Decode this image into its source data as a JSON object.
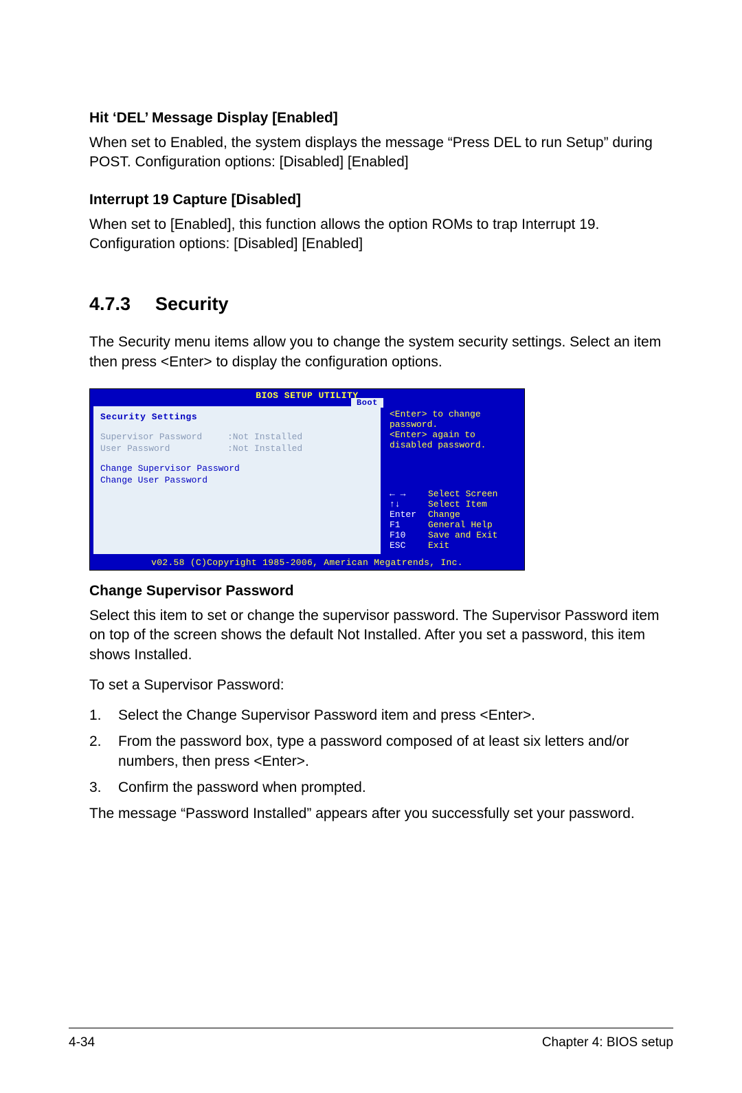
{
  "sec1": {
    "heading": "Hit ‘DEL’ Message Display [Enabled]",
    "para": "When set to Enabled, the system displays the message “Press DEL to run Setup” during POST. Configuration options: [Disabled] [Enabled]"
  },
  "sec2": {
    "heading": "Interrupt 19 Capture [Disabled]",
    "para": "When set to [Enabled], this function allows the option ROMs to trap Interrupt 19. Configuration options: [Disabled] [Enabled]"
  },
  "section": {
    "num": "4.7.3",
    "title": "Security",
    "intro": "The Security menu items allow you to change the system security settings. Select an item then press <Enter> to display the configuration options."
  },
  "bios": {
    "title": "BIOS SETUP UTILITY",
    "tab": "Boot",
    "left_title": "Security Settings",
    "rows": [
      {
        "label": "Supervisor Password",
        "value": ":Not Installed"
      },
      {
        "label": "User Password",
        "value": ":Not Installed"
      }
    ],
    "change1": "Change Supervisor Password",
    "change2": "Change User Password",
    "help": "<Enter> to change password.\n<Enter> again to disabled password.",
    "nav": [
      {
        "key": "← →",
        "txt": "Select Screen"
      },
      {
        "key": "↑↓",
        "txt": "Select Item"
      },
      {
        "key": "Enter",
        "txt": "Change"
      },
      {
        "key": "F1",
        "txt": "General Help"
      },
      {
        "key": "F10",
        "txt": "Save and Exit"
      },
      {
        "key": "ESC",
        "txt": "Exit"
      }
    ],
    "footer": "v02.58 (C)Copyright 1985-2006, American Megatrends, Inc."
  },
  "csp": {
    "heading": "Change Supervisor Password",
    "para": "Select this item to set or change the supervisor password. The Supervisor Password item on top of the screen shows the default Not Installed. After you set a password, this item shows Installed.",
    "lead": "To set a Supervisor Password:",
    "steps": [
      "Select the Change Supervisor Password item and press <Enter>.",
      "From the password box, type a password composed of at least six letters and/or numbers, then press <Enter>.",
      "Confirm the password when prompted."
    ],
    "after": "The message “Password Installed” appears after you successfully set your password."
  },
  "pagefoot": {
    "left": "4-34",
    "right": "Chapter 4: BIOS setup"
  }
}
